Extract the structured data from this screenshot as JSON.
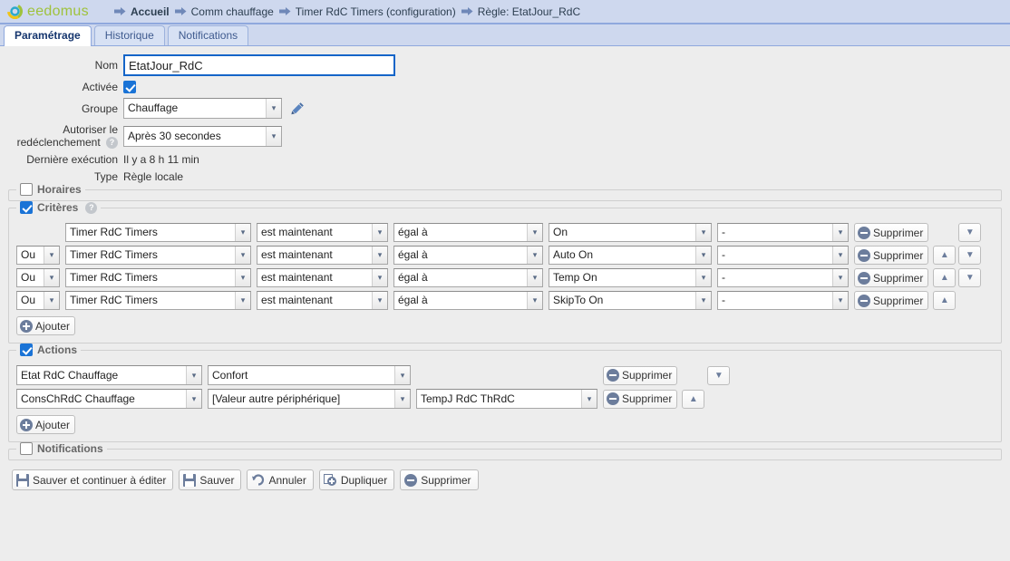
{
  "brand": {
    "name_part1": "ee",
    "name_part2": "domus"
  },
  "breadcrumb": [
    {
      "label": "Accueil",
      "icon": "arrow-right-icon"
    },
    {
      "label": "Comm chauffage",
      "icon": "arrow-right-icon"
    },
    {
      "label": "Timer RdC Timers (configuration)",
      "icon": "arrow-right-icon"
    },
    {
      "label": "Règle: EtatJour_RdC",
      "icon": "arrow-right-icon"
    }
  ],
  "tabs": [
    {
      "label": "Paramétrage",
      "active": true
    },
    {
      "label": "Historique",
      "active": false
    },
    {
      "label": "Notifications",
      "active": false
    }
  ],
  "form": {
    "nom_label": "Nom",
    "nom_value": "EtatJour_RdC",
    "activee_label": "Activée",
    "activee_checked": true,
    "groupe_label": "Groupe",
    "groupe_value": "Chauffage",
    "edit_icon": "pencil-icon",
    "redecl_label_line1": "Autoriser le",
    "redecl_label_line2": "redéclenchement",
    "redecl_value": "Après 30 secondes",
    "derniere_label": "Dernière exécution",
    "derniere_value": "Il y a 8 h 11 min",
    "type_label": "Type",
    "type_value": "Règle locale"
  },
  "sections": {
    "horaires": {
      "legend": "Horaires",
      "checked": false
    },
    "criteres": {
      "legend": "Critères",
      "checked": true,
      "help_icon": "question-icon"
    },
    "actions": {
      "legend": "Actions",
      "checked": true
    },
    "notifications": {
      "legend": "Notifications",
      "checked": false
    }
  },
  "criteria": {
    "add_label": "Ajouter",
    "delete_label": "Supprimer",
    "up_icon": "arrow-up-icon",
    "down_icon": "arrow-down-icon",
    "rows": [
      {
        "conj": "",
        "has_conj": false,
        "device": "Timer RdC Timers",
        "condition": "est maintenant",
        "operator": "égal à",
        "value": "On",
        "extra": "-",
        "can_up": false,
        "can_down": true
      },
      {
        "conj": "Ou",
        "has_conj": true,
        "device": "Timer RdC Timers",
        "condition": "est maintenant",
        "operator": "égal à",
        "value": "Auto On",
        "extra": "-",
        "can_up": true,
        "can_down": true
      },
      {
        "conj": "Ou",
        "has_conj": true,
        "device": "Timer RdC Timers",
        "condition": "est maintenant",
        "operator": "égal à",
        "value": "Temp On",
        "extra": "-",
        "can_up": true,
        "can_down": true
      },
      {
        "conj": "Ou",
        "has_conj": true,
        "device": "Timer RdC Timers",
        "condition": "est maintenant",
        "operator": "égal à",
        "value": "SkipTo On",
        "extra": "-",
        "can_up": true,
        "can_down": false
      }
    ]
  },
  "actions": {
    "add_label": "Ajouter",
    "delete_label": "Supprimer",
    "rows": [
      {
        "device": "Etat RdC Chauffage",
        "value": "Confort",
        "extra": "",
        "has_extra": false,
        "can_up": false,
        "can_down": true
      },
      {
        "device": "ConsChRdC Chauffage",
        "value": "[Valeur autre périphérique]",
        "extra": "TempJ RdC ThRdC",
        "has_extra": true,
        "can_up": true,
        "can_down": false
      }
    ]
  },
  "toolbar": [
    {
      "label": "Sauver et continuer à éditer",
      "icon": "save-icon"
    },
    {
      "label": "Sauver",
      "icon": "save-icon"
    },
    {
      "label": "Annuler",
      "icon": "undo-icon"
    },
    {
      "label": "Dupliquer",
      "icon": "duplicate-icon"
    },
    {
      "label": "Supprimer",
      "icon": "delete-icon"
    }
  ],
  "colors": {
    "header_bg": "#ced8ee",
    "accent_blue": "#1565c8",
    "body_bg": "#ededed",
    "icon_blue": "#6c7d9c"
  }
}
